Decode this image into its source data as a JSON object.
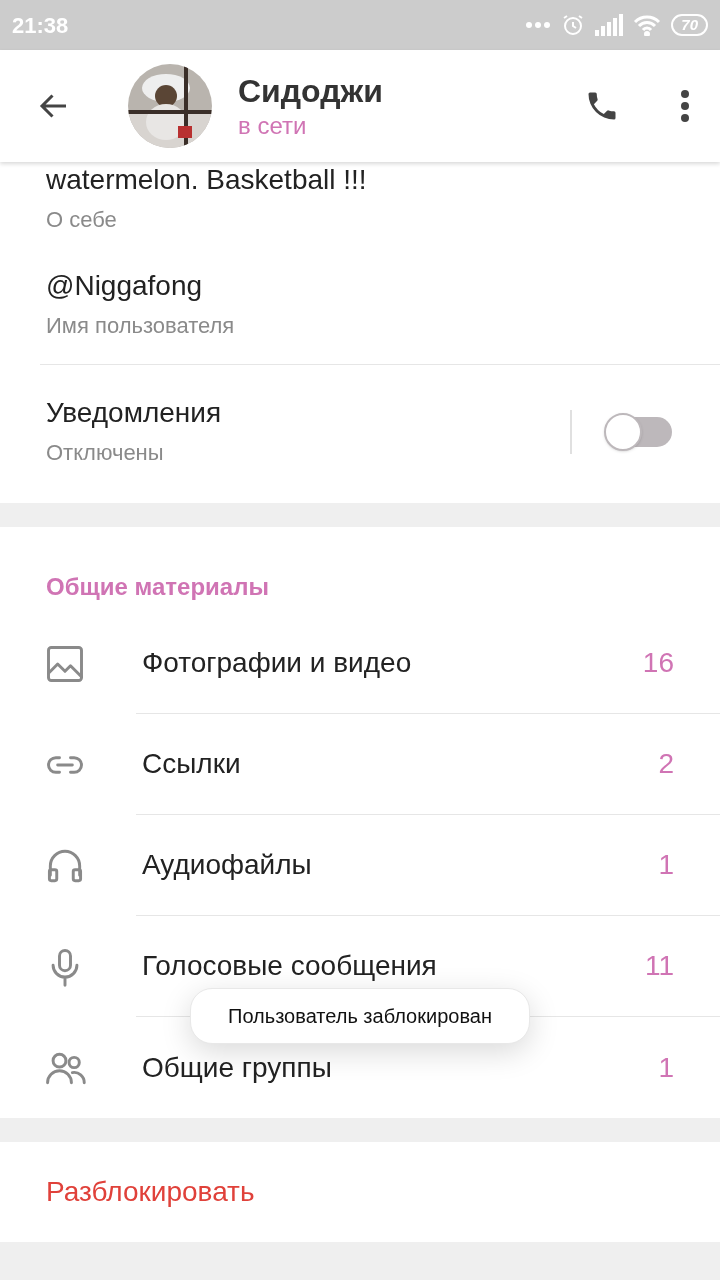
{
  "status_bar": {
    "time": "21:38",
    "battery": "70"
  },
  "header": {
    "name": "Сидоджи",
    "status": "в сети"
  },
  "info": [
    {
      "value": "watermelon. Basketball !!!",
      "label": "О себе"
    },
    {
      "value": "@Niggafong",
      "label": "Имя пользователя"
    }
  ],
  "notifications": {
    "title": "Уведомления",
    "value": "Отключены",
    "on": false
  },
  "shared": {
    "title": "Общие материалы",
    "items": [
      {
        "kind": "photos",
        "label": "Фотографии и видео",
        "count": "16"
      },
      {
        "kind": "links",
        "label": "Ссылки",
        "count": "2"
      },
      {
        "kind": "audio",
        "label": "Аудиофайлы",
        "count": "1"
      },
      {
        "kind": "voice",
        "label": "Голосовые сообщения",
        "count": "11"
      },
      {
        "kind": "groups",
        "label": "Общие группы",
        "count": "1"
      }
    ]
  },
  "unblock": "Разблокировать",
  "toast": "Пользователь заблокирован"
}
